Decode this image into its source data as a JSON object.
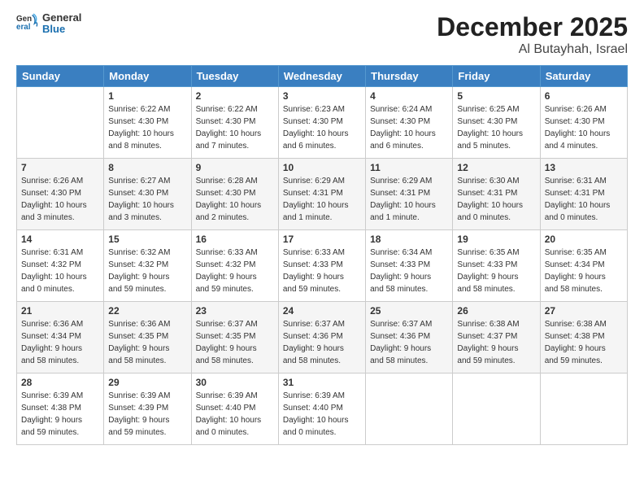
{
  "header": {
    "logo_general": "General",
    "logo_blue": "Blue",
    "month": "December 2025",
    "location": "Al Butayhah, Israel"
  },
  "weekdays": [
    "Sunday",
    "Monday",
    "Tuesday",
    "Wednesday",
    "Thursday",
    "Friday",
    "Saturday"
  ],
  "weeks": [
    [
      {
        "day": "",
        "info": ""
      },
      {
        "day": "1",
        "info": "Sunrise: 6:22 AM\nSunset: 4:30 PM\nDaylight: 10 hours\nand 8 minutes."
      },
      {
        "day": "2",
        "info": "Sunrise: 6:22 AM\nSunset: 4:30 PM\nDaylight: 10 hours\nand 7 minutes."
      },
      {
        "day": "3",
        "info": "Sunrise: 6:23 AM\nSunset: 4:30 PM\nDaylight: 10 hours\nand 6 minutes."
      },
      {
        "day": "4",
        "info": "Sunrise: 6:24 AM\nSunset: 4:30 PM\nDaylight: 10 hours\nand 6 minutes."
      },
      {
        "day": "5",
        "info": "Sunrise: 6:25 AM\nSunset: 4:30 PM\nDaylight: 10 hours\nand 5 minutes."
      },
      {
        "day": "6",
        "info": "Sunrise: 6:26 AM\nSunset: 4:30 PM\nDaylight: 10 hours\nand 4 minutes."
      }
    ],
    [
      {
        "day": "7",
        "info": "Sunrise: 6:26 AM\nSunset: 4:30 PM\nDaylight: 10 hours\nand 3 minutes."
      },
      {
        "day": "8",
        "info": "Sunrise: 6:27 AM\nSunset: 4:30 PM\nDaylight: 10 hours\nand 3 minutes."
      },
      {
        "day": "9",
        "info": "Sunrise: 6:28 AM\nSunset: 4:30 PM\nDaylight: 10 hours\nand 2 minutes."
      },
      {
        "day": "10",
        "info": "Sunrise: 6:29 AM\nSunset: 4:31 PM\nDaylight: 10 hours\nand 1 minute."
      },
      {
        "day": "11",
        "info": "Sunrise: 6:29 AM\nSunset: 4:31 PM\nDaylight: 10 hours\nand 1 minute."
      },
      {
        "day": "12",
        "info": "Sunrise: 6:30 AM\nSunset: 4:31 PM\nDaylight: 10 hours\nand 0 minutes."
      },
      {
        "day": "13",
        "info": "Sunrise: 6:31 AM\nSunset: 4:31 PM\nDaylight: 10 hours\nand 0 minutes."
      }
    ],
    [
      {
        "day": "14",
        "info": "Sunrise: 6:31 AM\nSunset: 4:32 PM\nDaylight: 10 hours\nand 0 minutes."
      },
      {
        "day": "15",
        "info": "Sunrise: 6:32 AM\nSunset: 4:32 PM\nDaylight: 9 hours\nand 59 minutes."
      },
      {
        "day": "16",
        "info": "Sunrise: 6:33 AM\nSunset: 4:32 PM\nDaylight: 9 hours\nand 59 minutes."
      },
      {
        "day": "17",
        "info": "Sunrise: 6:33 AM\nSunset: 4:33 PM\nDaylight: 9 hours\nand 59 minutes."
      },
      {
        "day": "18",
        "info": "Sunrise: 6:34 AM\nSunset: 4:33 PM\nDaylight: 9 hours\nand 58 minutes."
      },
      {
        "day": "19",
        "info": "Sunrise: 6:35 AM\nSunset: 4:33 PM\nDaylight: 9 hours\nand 58 minutes."
      },
      {
        "day": "20",
        "info": "Sunrise: 6:35 AM\nSunset: 4:34 PM\nDaylight: 9 hours\nand 58 minutes."
      }
    ],
    [
      {
        "day": "21",
        "info": "Sunrise: 6:36 AM\nSunset: 4:34 PM\nDaylight: 9 hours\nand 58 minutes."
      },
      {
        "day": "22",
        "info": "Sunrise: 6:36 AM\nSunset: 4:35 PM\nDaylight: 9 hours\nand 58 minutes."
      },
      {
        "day": "23",
        "info": "Sunrise: 6:37 AM\nSunset: 4:35 PM\nDaylight: 9 hours\nand 58 minutes."
      },
      {
        "day": "24",
        "info": "Sunrise: 6:37 AM\nSunset: 4:36 PM\nDaylight: 9 hours\nand 58 minutes."
      },
      {
        "day": "25",
        "info": "Sunrise: 6:37 AM\nSunset: 4:36 PM\nDaylight: 9 hours\nand 58 minutes."
      },
      {
        "day": "26",
        "info": "Sunrise: 6:38 AM\nSunset: 4:37 PM\nDaylight: 9 hours\nand 59 minutes."
      },
      {
        "day": "27",
        "info": "Sunrise: 6:38 AM\nSunset: 4:38 PM\nDaylight: 9 hours\nand 59 minutes."
      }
    ],
    [
      {
        "day": "28",
        "info": "Sunrise: 6:39 AM\nSunset: 4:38 PM\nDaylight: 9 hours\nand 59 minutes."
      },
      {
        "day": "29",
        "info": "Sunrise: 6:39 AM\nSunset: 4:39 PM\nDaylight: 9 hours\nand 59 minutes."
      },
      {
        "day": "30",
        "info": "Sunrise: 6:39 AM\nSunset: 4:40 PM\nDaylight: 10 hours\nand 0 minutes."
      },
      {
        "day": "31",
        "info": "Sunrise: 6:39 AM\nSunset: 4:40 PM\nDaylight: 10 hours\nand 0 minutes."
      },
      {
        "day": "",
        "info": ""
      },
      {
        "day": "",
        "info": ""
      },
      {
        "day": "",
        "info": ""
      }
    ]
  ]
}
